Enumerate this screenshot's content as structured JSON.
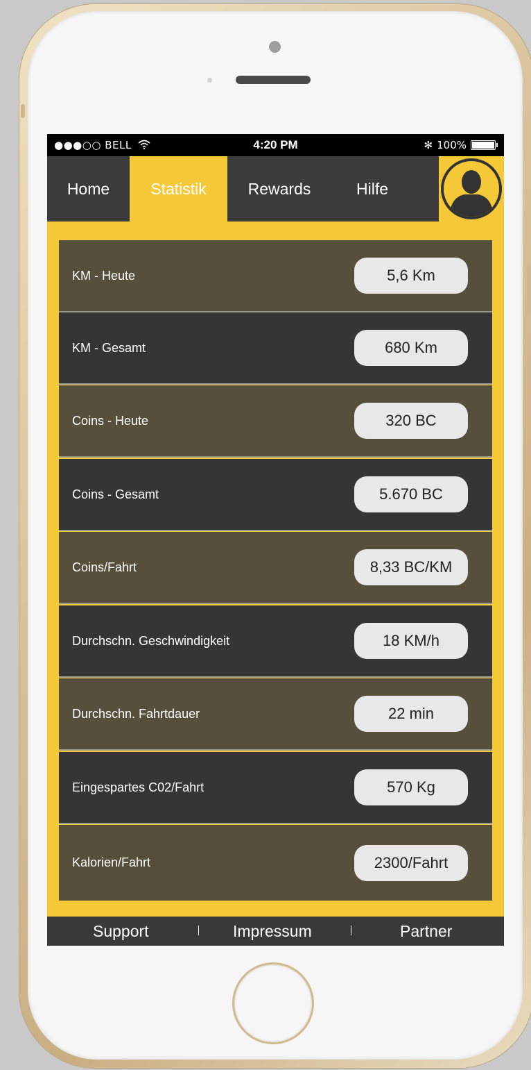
{
  "statusbar": {
    "signal": "●●●○○ BELL",
    "wifi_icon": "wifi-icon",
    "time": "4:20 PM",
    "bluetooth": "✻",
    "battery_text": "100%"
  },
  "nav": {
    "tabs": [
      {
        "label": "Home",
        "active": false
      },
      {
        "label": "Statistik",
        "active": true
      },
      {
        "label": "Rewards",
        "active": false
      },
      {
        "label": "Hilfe",
        "active": false
      }
    ],
    "avatar_icon": "user-avatar-icon"
  },
  "stats": [
    {
      "label": "KM - Heute",
      "value": "5,6 Km"
    },
    {
      "label": "KM - Gesamt",
      "value": "680 Km"
    },
    {
      "label": "Coins - Heute",
      "value": "320 BC"
    },
    {
      "label": "Coins - Gesamt",
      "value": "5.670 BC"
    },
    {
      "label": "Coins/Fahrt",
      "value": "8,33 BC/KM"
    },
    {
      "label": "Durchschn. Geschwindigkeit",
      "value": "18 KM/h"
    },
    {
      "label": "Durchschn. Fahrtdauer",
      "value": "22 min"
    },
    {
      "label": "Eingespartes C02/Fahrt",
      "value": "570 Kg"
    },
    {
      "label": "Kalorien/Fahrt",
      "value": "2300/Fahrt"
    }
  ],
  "footer": {
    "links": [
      "Support",
      "Impressum",
      "Partner"
    ]
  },
  "colors": {
    "accent": "#f5c838",
    "nav_bg": "#3b3b3b",
    "row_olive": "#564f3c",
    "row_dark": "#353535",
    "pill_bg": "#e8e8e8"
  }
}
